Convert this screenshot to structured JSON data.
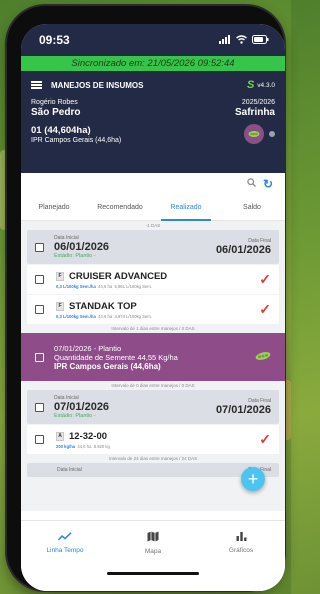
{
  "status": {
    "time": "09:53"
  },
  "sync_banner": "Sincronizado em: 21/05/2026 09:52:44",
  "appbar": {
    "title": "MANEJOS DE INSUMOS",
    "version": "v4.3.0",
    "user": "Rogério Robes",
    "farm": "São Pedro",
    "season_year": "2025/2026",
    "season": "Safrinha",
    "field": "01 (44,604ha)",
    "field_sub": "IPR Campos Gerais (44,6ha)"
  },
  "tabs": [
    {
      "label": "Planejado"
    },
    {
      "label": "Recomendado"
    },
    {
      "label": "Realizado"
    },
    {
      "label": "Saldo"
    }
  ],
  "list": {
    "sep0": "-1 DAS",
    "card1": {
      "start_lbl": "Data Inicial",
      "start": "06/01/2026",
      "end_lbl": "Data Final",
      "end": "06/01/2026",
      "stage": "Estádio: Plantio -"
    },
    "prod1": {
      "tag": "F",
      "name": "CRUISER ADVANCED",
      "dose": "0,3 L/100kg Sem./ha",
      "area": "44,6 ha",
      "total": "5,961 L/100kg Sem."
    },
    "prod2": {
      "tag": "F",
      "name": "STANDAK TOP",
      "dose": "0,3 L/100kg Sem./ha",
      "area": "44,6 ha",
      "total": "3,974 L/100kg Sem."
    },
    "sep1": "Intervalo de 1 dias entre manejos / 0 DAS",
    "plant": {
      "l1": "07/01/2026 - Plantio",
      "l2": "Quantidade de Semente 44,55 Kg/ha",
      "l3": "IPR Campos Gerais (44,6ha)"
    },
    "sep2": "Intervalo de 0 dias entre manejos / 0 DAS",
    "card2": {
      "start_lbl": "Data Inicial",
      "start": "07/01/2026",
      "end_lbl": "Data Final",
      "end": "07/01/2026",
      "stage": "Estádio: Plantio -"
    },
    "prod3": {
      "tag": "A",
      "name": "12-32-00",
      "dose": "200 kg/ha",
      "area": "44,6 ha",
      "total": "8.920 kg"
    },
    "sep3": "Intervalo de 24 dias entre manejos / 24 DAS",
    "card3": {
      "start_lbl": "Data Inicial",
      "end_lbl": "Data Final"
    }
  },
  "bottomnav": [
    {
      "label": "Linha Tempo"
    },
    {
      "label": "Mapa"
    },
    {
      "label": "Gráficos"
    }
  ],
  "colors": {
    "navy": "#232a45",
    "green": "#37c44a",
    "blue": "#2e86de",
    "purple": "#8e4d89",
    "red": "#e53935"
  }
}
